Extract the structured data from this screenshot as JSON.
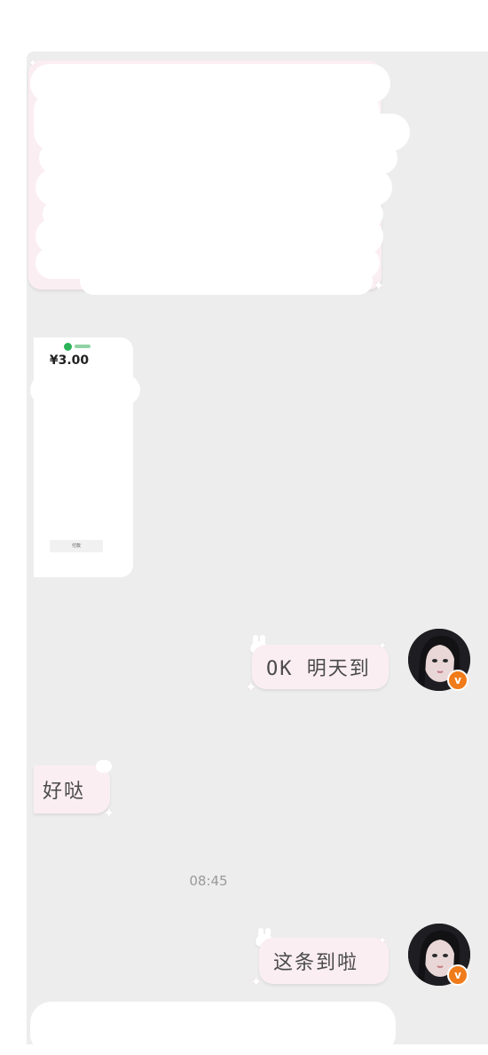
{
  "messages": {
    "received_payment": {
      "amount": "¥3.00",
      "button_label": "付款"
    },
    "sent_1": {
      "text": "OK 明天到"
    },
    "received_1": {
      "text": "好哒"
    },
    "timestamp": "08:45",
    "sent_2": {
      "text": "这条到啦"
    }
  },
  "colors": {
    "chat_background": "#ededed",
    "bubble": "#fbeef2",
    "verified_badge": "#f07b1a"
  },
  "icons": {
    "verified_badge": "verified-v-icon",
    "decoration": "sparkle-icon"
  },
  "user": {
    "verified_mark": "v"
  }
}
